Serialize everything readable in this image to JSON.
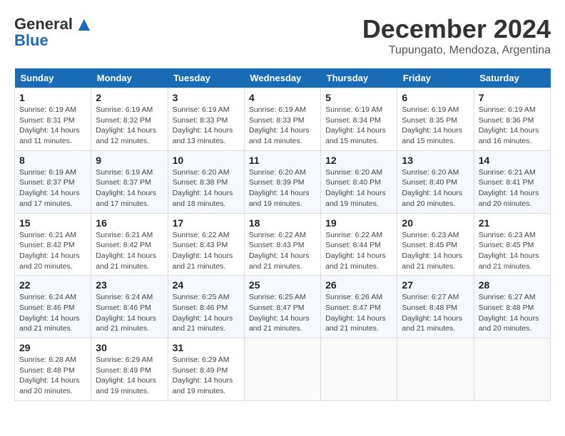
{
  "logo": {
    "line1": "General",
    "line2": "Blue"
  },
  "header": {
    "month": "December 2024",
    "location": "Tupungato, Mendoza, Argentina"
  },
  "weekdays": [
    "Sunday",
    "Monday",
    "Tuesday",
    "Wednesday",
    "Thursday",
    "Friday",
    "Saturday"
  ],
  "weeks": [
    [
      {
        "day": "1",
        "sunrise": "6:19 AM",
        "sunset": "8:31 PM",
        "daylight": "14 hours and 11 minutes."
      },
      {
        "day": "2",
        "sunrise": "6:19 AM",
        "sunset": "8:32 PM",
        "daylight": "14 hours and 12 minutes."
      },
      {
        "day": "3",
        "sunrise": "6:19 AM",
        "sunset": "8:33 PM",
        "daylight": "14 hours and 13 minutes."
      },
      {
        "day": "4",
        "sunrise": "6:19 AM",
        "sunset": "8:33 PM",
        "daylight": "14 hours and 14 minutes."
      },
      {
        "day": "5",
        "sunrise": "6:19 AM",
        "sunset": "8:34 PM",
        "daylight": "14 hours and 15 minutes."
      },
      {
        "day": "6",
        "sunrise": "6:19 AM",
        "sunset": "8:35 PM",
        "daylight": "14 hours and 15 minutes."
      },
      {
        "day": "7",
        "sunrise": "6:19 AM",
        "sunset": "8:36 PM",
        "daylight": "14 hours and 16 minutes."
      }
    ],
    [
      {
        "day": "8",
        "sunrise": "6:19 AM",
        "sunset": "8:37 PM",
        "daylight": "14 hours and 17 minutes."
      },
      {
        "day": "9",
        "sunrise": "6:19 AM",
        "sunset": "8:37 PM",
        "daylight": "14 hours and 17 minutes."
      },
      {
        "day": "10",
        "sunrise": "6:20 AM",
        "sunset": "8:38 PM",
        "daylight": "14 hours and 18 minutes."
      },
      {
        "day": "11",
        "sunrise": "6:20 AM",
        "sunset": "8:39 PM",
        "daylight": "14 hours and 19 minutes."
      },
      {
        "day": "12",
        "sunrise": "6:20 AM",
        "sunset": "8:40 PM",
        "daylight": "14 hours and 19 minutes."
      },
      {
        "day": "13",
        "sunrise": "6:20 AM",
        "sunset": "8:40 PM",
        "daylight": "14 hours and 20 minutes."
      },
      {
        "day": "14",
        "sunrise": "6:21 AM",
        "sunset": "8:41 PM",
        "daylight": "14 hours and 20 minutes."
      }
    ],
    [
      {
        "day": "15",
        "sunrise": "6:21 AM",
        "sunset": "8:42 PM",
        "daylight": "14 hours and 20 minutes."
      },
      {
        "day": "16",
        "sunrise": "6:21 AM",
        "sunset": "8:42 PM",
        "daylight": "14 hours and 21 minutes."
      },
      {
        "day": "17",
        "sunrise": "6:22 AM",
        "sunset": "8:43 PM",
        "daylight": "14 hours and 21 minutes."
      },
      {
        "day": "18",
        "sunrise": "6:22 AM",
        "sunset": "8:43 PM",
        "daylight": "14 hours and 21 minutes."
      },
      {
        "day": "19",
        "sunrise": "6:22 AM",
        "sunset": "8:44 PM",
        "daylight": "14 hours and 21 minutes."
      },
      {
        "day": "20",
        "sunrise": "6:23 AM",
        "sunset": "8:45 PM",
        "daylight": "14 hours and 21 minutes."
      },
      {
        "day": "21",
        "sunrise": "6:23 AM",
        "sunset": "8:45 PM",
        "daylight": "14 hours and 21 minutes."
      }
    ],
    [
      {
        "day": "22",
        "sunrise": "6:24 AM",
        "sunset": "8:46 PM",
        "daylight": "14 hours and 21 minutes."
      },
      {
        "day": "23",
        "sunrise": "6:24 AM",
        "sunset": "8:46 PM",
        "daylight": "14 hours and 21 minutes."
      },
      {
        "day": "24",
        "sunrise": "6:25 AM",
        "sunset": "8:46 PM",
        "daylight": "14 hours and 21 minutes."
      },
      {
        "day": "25",
        "sunrise": "6:25 AM",
        "sunset": "8:47 PM",
        "daylight": "14 hours and 21 minutes."
      },
      {
        "day": "26",
        "sunrise": "6:26 AM",
        "sunset": "8:47 PM",
        "daylight": "14 hours and 21 minutes."
      },
      {
        "day": "27",
        "sunrise": "6:27 AM",
        "sunset": "8:48 PM",
        "daylight": "14 hours and 21 minutes."
      },
      {
        "day": "28",
        "sunrise": "6:27 AM",
        "sunset": "8:48 PM",
        "daylight": "14 hours and 20 minutes."
      }
    ],
    [
      {
        "day": "29",
        "sunrise": "6:28 AM",
        "sunset": "8:48 PM",
        "daylight": "14 hours and 20 minutes."
      },
      {
        "day": "30",
        "sunrise": "6:29 AM",
        "sunset": "8:49 PM",
        "daylight": "14 hours and 19 minutes."
      },
      {
        "day": "31",
        "sunrise": "6:29 AM",
        "sunset": "8:49 PM",
        "daylight": "14 hours and 19 minutes."
      },
      null,
      null,
      null,
      null
    ]
  ],
  "labels": {
    "sunrise": "Sunrise:",
    "sunset": "Sunset:",
    "daylight": "Daylight:"
  }
}
